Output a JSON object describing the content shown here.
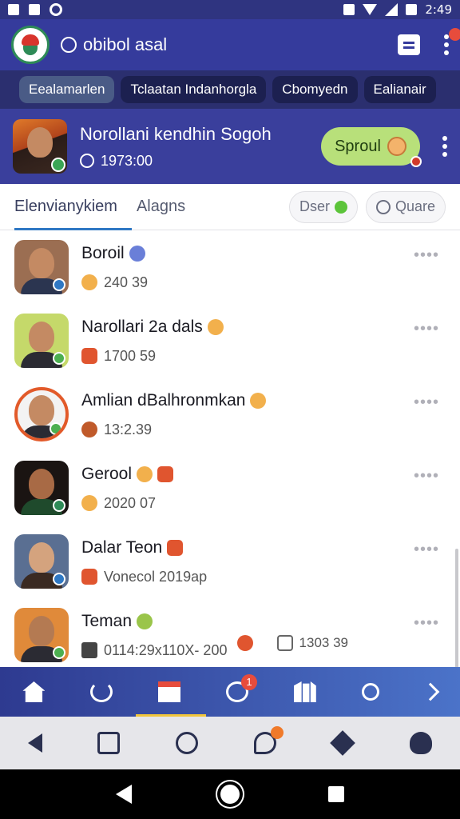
{
  "status": {
    "time": "2:49"
  },
  "app": {
    "title": "obibol asal"
  },
  "categories": [
    {
      "label": "Eealamarlen",
      "active": true
    },
    {
      "label": "Tclaatan Indanhorgla",
      "active": false
    },
    {
      "label": "Cbomyedn",
      "active": false
    },
    {
      "label": "Ealianair",
      "active": false
    }
  ],
  "header": {
    "title": "Norollani kendhin Sogoh",
    "subtitle": "1973:00",
    "button_label": "Sproul"
  },
  "tabs": {
    "primary": "Elenvianykiem",
    "secondary": "Alagns",
    "pill_1": "Dser",
    "pill_2": "Quare"
  },
  "contacts": [
    {
      "name": "Boroil",
      "sub": "240 39"
    },
    {
      "name": "Narollari 2a dals",
      "sub": "1700 59"
    },
    {
      "name": "Amlian dBalhronmkan",
      "sub": "13:2.39"
    },
    {
      "name": "Gerool",
      "sub": "2020 07"
    },
    {
      "name": "Dalar Teon",
      "sub": "Vonecol 2019ap"
    },
    {
      "name": "Teman",
      "sub": "0114:29x110X- 200",
      "extra": "1303 39"
    }
  ],
  "more_glyph": "••••",
  "badges": {
    "gauge": "1"
  },
  "icons": [
    "home-icon",
    "refresh-icon",
    "store-icon",
    "gauge-icon",
    "books-icon",
    "search-icon",
    "next-icon",
    "back-icon",
    "note-icon",
    "alert-icon",
    "chat-icon",
    "diamond-icon",
    "user-icon"
  ],
  "colors": {
    "appbar": "#353b9c",
    "accent": "#2f78c4",
    "button": "#b8e07a",
    "badge": "#e74c3c"
  }
}
